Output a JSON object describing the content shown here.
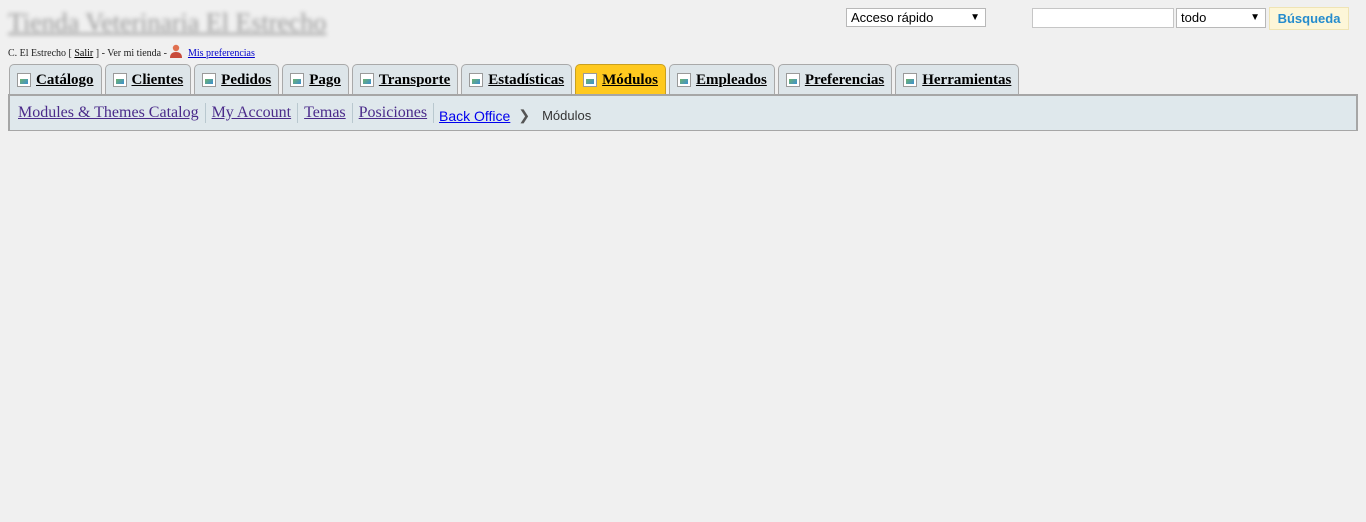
{
  "header": {
    "shop_title": "Tienda Veterinaria El Estrecho",
    "quick_access": "Acceso rápido",
    "search_value": "",
    "search_scope": "todo",
    "search_button": "Búsqueda"
  },
  "user_bar": {
    "name": "C. El Estrecho [",
    "logout": "Salir",
    "middle": "] - Ver mi tienda -",
    "preferences": "Mis preferencias"
  },
  "tabs": [
    {
      "label": "Catálogo"
    },
    {
      "label": "Clientes"
    },
    {
      "label": "Pedidos"
    },
    {
      "label": "Pago"
    },
    {
      "label": "Transporte"
    },
    {
      "label": "Estadísticas"
    },
    {
      "label": "Módulos",
      "active": true
    },
    {
      "label": "Empleados"
    },
    {
      "label": "Preferencias"
    },
    {
      "label": "Herramientas"
    }
  ],
  "subnav": {
    "links": [
      "Modules & Themes Catalog",
      "My Account",
      "Temas",
      "Posiciones"
    ]
  },
  "breadcrumb": {
    "root": "Back Office",
    "current": "Módulos"
  },
  "colors": {
    "background": "#f0f0f0",
    "tab_bg": "#dde5e9",
    "active_tab": "#ffc91f",
    "search_button_text": "#268ccd"
  }
}
